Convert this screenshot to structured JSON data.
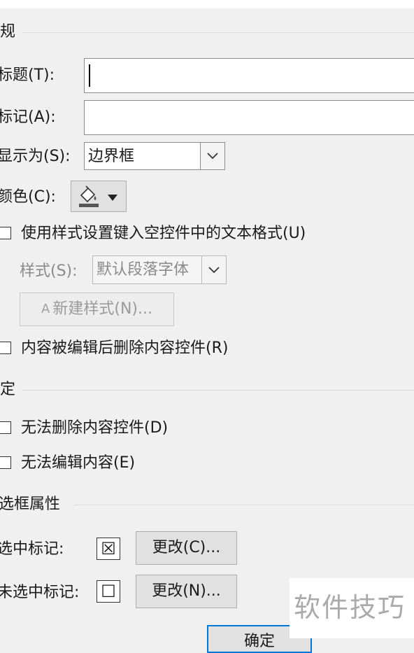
{
  "general": {
    "section_title": "规",
    "title_label": "标题(T):",
    "title_value": "",
    "tag_label": "标记(A):",
    "tag_value": "",
    "show_as_label": "显示为(S):",
    "show_as_value": "边界框",
    "color_label": "颜色(C):",
    "use_style_label": "使用样式设置键入空控件中的文本格式(U)",
    "style_label": "样式(S):",
    "style_value": "默认段落字体",
    "new_style_button": "新建样式(N)...",
    "new_style_icon_text": "A",
    "remove_after_edit_label": "内容被编辑后删除内容控件(R)"
  },
  "locking": {
    "section_title": "定",
    "cannot_delete_label": "无法删除内容控件(D)",
    "cannot_edit_label": "无法编辑内容(E)"
  },
  "checkbox_props": {
    "section_title": "选框属性",
    "checked_label": "选中标记:",
    "checked_symbol": "☒",
    "checked_change_button": "更改(C)...",
    "unchecked_label": "未选中标记:",
    "unchecked_symbol": "☐",
    "unchecked_change_button": "更改(N)..."
  },
  "footer": {
    "ok_button": "确定"
  },
  "watermark": "软件技巧",
  "colors": {
    "background": "#f0f0f0",
    "button": "#e1e1e1",
    "border": "#8c8c8c",
    "disabled_text": "#8a8a8a"
  }
}
